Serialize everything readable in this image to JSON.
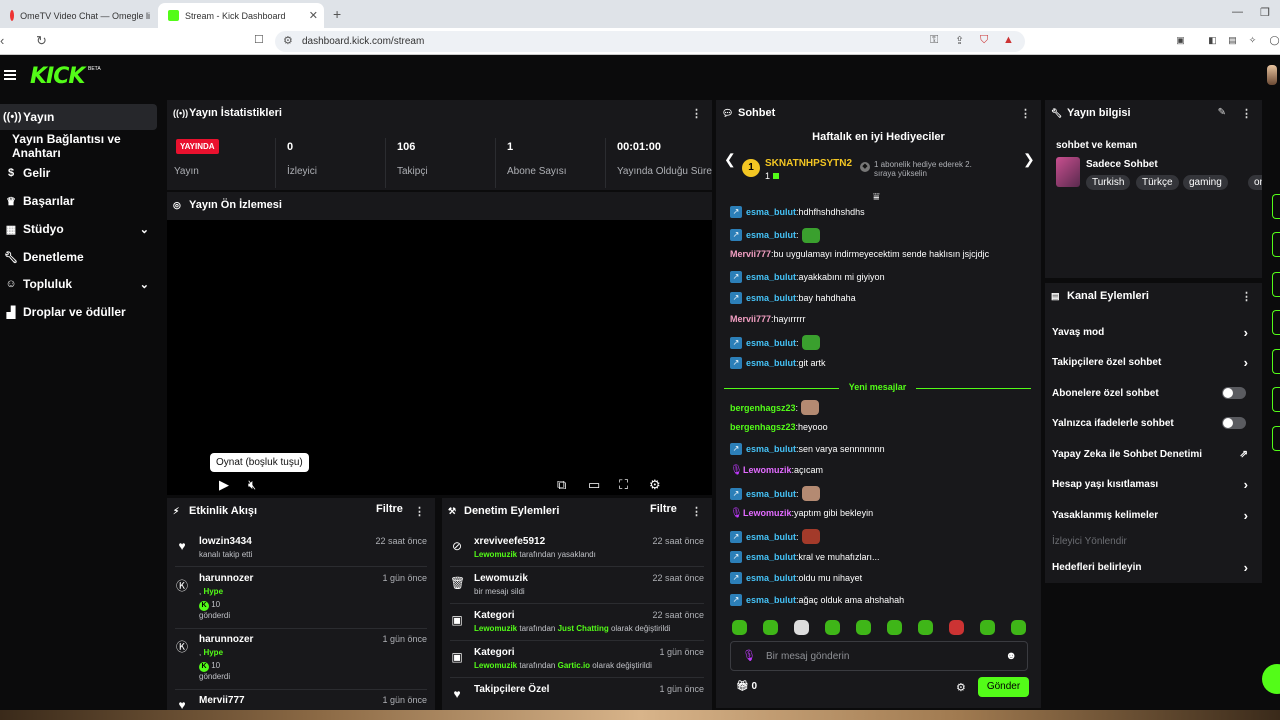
{
  "browser": {
    "tabs": [
      {
        "title": "OmeTV Video Chat — Omegle li",
        "active": false
      },
      {
        "title": "Stream - Kick Dashboard",
        "active": true
      }
    ],
    "url": "dashboard.kick.com/stream",
    "brand_color": "#53fc18"
  },
  "app": {
    "logo": "KICK",
    "beta": "BETA"
  },
  "sidebar": {
    "items": [
      {
        "label": "Yayın",
        "icon": "broadcast-icon",
        "active": true
      },
      {
        "label": "Yayın Bağlantısı ve Anahtarı",
        "icon": "",
        "active": false
      },
      {
        "label": "Gelir",
        "icon": "dollar-icon",
        "active": false
      },
      {
        "label": "Başarılar",
        "icon": "trophy-icon",
        "active": false
      },
      {
        "label": "Stüdyo",
        "icon": "film-icon",
        "active": false,
        "expandable": true
      },
      {
        "label": "Denetleme",
        "icon": "wrench-icon",
        "active": false
      },
      {
        "label": "Topluluk",
        "icon": "people-icon",
        "active": false,
        "expandable": true
      },
      {
        "label": "Droplar ve ödüller",
        "icon": "gift-icon",
        "active": false
      }
    ]
  },
  "stats": {
    "title": "Yayın İstatistikleri",
    "badge": "YAYINDA",
    "status_label": "Yayın",
    "items": [
      {
        "value": "0",
        "label": "İzleyici"
      },
      {
        "value": "106",
        "label": "Takipçi"
      },
      {
        "value": "1",
        "label": "Abone Sayısı"
      },
      {
        "value": "00:01:00",
        "label": "Yayında Olduğu Süre"
      }
    ]
  },
  "preview": {
    "title": "Yayın Ön İzlemesi",
    "tooltip": "Oynat (boşluk tuşu)"
  },
  "activity": {
    "title": "Etkinlik Akışı",
    "filter": "Filtre",
    "rows": [
      {
        "name": "lowzin3434",
        "sub": "kanalı takip etti",
        "time": "22 saat önce",
        "icon": "heart-icon"
      },
      {
        "name": "harunnozer",
        "line1_prefix": ", ",
        "line1_highlight": "Hype",
        "amount": "10",
        "sub": "gönderdi",
        "time": "1 gün önce",
        "icon": "kick-icon"
      },
      {
        "name": "harunnozer",
        "line1_prefix": ", ",
        "line1_highlight": "Hype",
        "amount": "10",
        "sub": "gönderdi",
        "time": "1 gün önce",
        "icon": "kick-icon"
      },
      {
        "name": "Mervii777",
        "time": "1 gün önce",
        "icon": "heart-icon"
      }
    ]
  },
  "moderation": {
    "title": "Denetim Eylemleri",
    "filter": "Filtre",
    "rows": [
      {
        "name": "xreviveefe5912",
        "actor": "Lewomuzik",
        "sub": " tarafından yasaklandı",
        "time": "22 saat önce",
        "icon": "ban-icon"
      },
      {
        "name": "Lewomuzik",
        "sub": "bir mesajı sildi",
        "time": "22 saat önce",
        "icon": "trash-icon"
      },
      {
        "name": "Kategori",
        "actor": "Lewomuzik",
        "sub": " tarafından ",
        "target": "Just Chatting",
        "suffix": " olarak değiştirildi",
        "time": "22 saat önce",
        "icon": "category-icon"
      },
      {
        "name": "Kategori",
        "actor": "Lewomuzik",
        "sub": " tarafından ",
        "target": "Gartic.io",
        "suffix": " olarak değiştirildi",
        "time": "1 gün önce",
        "icon": "category-icon"
      },
      {
        "name": "Takipçilere Özel",
        "time": "1 gün önce",
        "icon": "heart-icon"
      }
    ]
  },
  "chat": {
    "title": "Sohbet",
    "gifter_title": "Haftalık en iyi Hediyeciler",
    "top_gifter": {
      "rank": "1",
      "name": "SKNATNHPSYTN2",
      "count": "1"
    },
    "gifter_note": "1 abonelik hediye ederek 2. sıraya yükselin",
    "messages": [
      {
        "user": "esma_bulut",
        "text": "hdhfhshdhshdhs",
        "color": "blue",
        "badge": true
      },
      {
        "user": "esma_bulut",
        "text": "",
        "color": "blue",
        "badge": true,
        "emote": "#3aa02e"
      },
      {
        "user": "Mervii777",
        "text": "bu uygulamayı indirmeyecektim sende haklısın jsjcjdjc",
        "color": "pink",
        "badge": false
      },
      {
        "user": "esma_bulut",
        "text": "ayakkabını mi giyiyon",
        "color": "blue",
        "badge": true
      },
      {
        "user": "esma_bulut",
        "text": "bay hahdhaha",
        "color": "blue",
        "badge": true
      },
      {
        "user": "Mervii777",
        "text": "hayırrrrr",
        "color": "pink",
        "badge": false
      },
      {
        "user": "esma_bulut",
        "text": "",
        "color": "blue",
        "badge": true,
        "emote": "#3aa02e"
      },
      {
        "user": "esma_bulut",
        "text": "git artk",
        "color": "blue",
        "badge": true
      }
    ],
    "new_messages": "Yeni mesajlar",
    "messages2": [
      {
        "user": "bergenhagsz23",
        "text": "",
        "color": "green",
        "badge": false,
        "emote": "#b48a72"
      },
      {
        "user": "bergenhagsz23",
        "text": "heyooo",
        "color": "green",
        "badge": false
      },
      {
        "user": "esma_bulut",
        "text": "sen varya sennnnnnn",
        "color": "blue",
        "badge": true
      },
      {
        "user": "Lewomuzik",
        "text": "açıcam",
        "color": "violet",
        "badge": false,
        "mic": true
      },
      {
        "user": "esma_bulut",
        "text": "",
        "color": "blue",
        "badge": true,
        "emote": "#b48a72"
      },
      {
        "user": "Lewomuzik",
        "text": "yaptım gibi bekleyin",
        "color": "violet",
        "badge": false,
        "mic": true
      },
      {
        "user": "esma_bulut",
        "text": "",
        "color": "blue",
        "badge": true,
        "emote": "#a33a2a"
      },
      {
        "user": "esma_bulut",
        "text": "kral ve muhafızları...",
        "color": "blue",
        "badge": true
      },
      {
        "user": "esma_bulut",
        "text": "oldu mu nihayet",
        "color": "blue",
        "badge": true
      },
      {
        "user": "esma_bulut",
        "text": "ağaç olduk ama ahshahah",
        "color": "blue",
        "badge": true
      }
    ],
    "input_placeholder": "Bir mesaj gönderin",
    "send": "Gönder",
    "points": "0"
  },
  "stream_info": {
    "title": "Yayın bilgisi",
    "stream_title": "sohbet ve keman",
    "category": "Sadece Sohbet",
    "tags": [
      "Turkish",
      "Türkçe",
      "gaming",
      "on"
    ]
  },
  "channel_actions": {
    "title": "Kanal Eylemleri",
    "items": [
      {
        "label": "Yavaş mod",
        "type": "chevron"
      },
      {
        "label": "Takipçilere özel sohbet",
        "type": "chevron"
      },
      {
        "label": "Abonelere özel sohbet",
        "type": "toggle"
      },
      {
        "label": "Yalnızca ifadelerle sohbet",
        "type": "toggle"
      },
      {
        "label": "Yapay Zeka ile Sohbet Denetimi",
        "type": "external"
      },
      {
        "label": "Hesap yaşı kısıtlaması",
        "type": "chevron"
      },
      {
        "label": "Yasaklanmış kelimeler",
        "type": "chevron"
      },
      {
        "label": "İzleyici Yönlendir",
        "type": "disabled"
      },
      {
        "label": "Hedefleri belirleyin",
        "type": "chevron"
      }
    ]
  }
}
